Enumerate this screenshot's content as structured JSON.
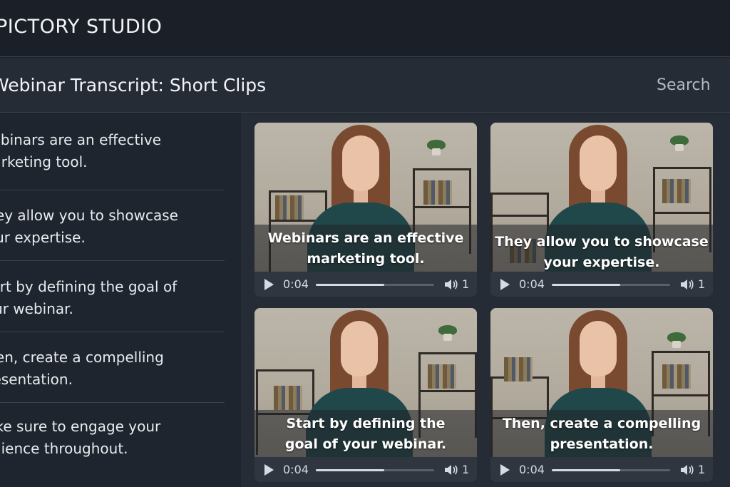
{
  "app": {
    "title": "PICTORY STUDIO"
  },
  "header": {
    "title": "Webinar Transcript: Short Clips",
    "search_label": "Search"
  },
  "transcript": [
    {
      "line1": "Webinars are an effective",
      "line2": "marketing tool."
    },
    {
      "line1": "They allow you to showcase",
      "line2": "your expertise."
    },
    {
      "line1": "Start by defining the goal of",
      "line2": "your webinar."
    },
    {
      "line1": "Then, create a compelling",
      "line2": "presentation."
    },
    {
      "line1": "Make sure to engage your",
      "line2": "audience throughout."
    }
  ],
  "clips": [
    {
      "caption1": "Webinars are an effective",
      "caption2": "marketing tool.",
      "time": "0:04",
      "volume": "1",
      "progress": 0.58
    },
    {
      "caption1": "They allow you to showcase",
      "caption2": "your expertise.",
      "time": "0:04",
      "volume": "1",
      "progress": 0.58
    },
    {
      "caption1": "Start by defining the",
      "caption2": "goal of your webinar.",
      "time": "0:04",
      "volume": "1",
      "progress": 0.58
    },
    {
      "caption1": "Then, create a compelling",
      "caption2": "presentation.",
      "time": "0:04",
      "volume": "1",
      "progress": 0.58
    }
  ],
  "colors": {
    "background": "#1d232c",
    "panel": "#262c36",
    "caption_text": "#ffffff",
    "sweater": "#20474a",
    "hair": "#7a4a30"
  },
  "icons": {
    "play": "play-icon",
    "volume": "volume-icon"
  }
}
